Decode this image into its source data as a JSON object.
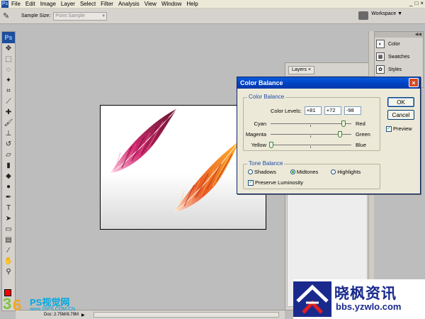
{
  "app": {
    "logo": "Ps",
    "menu": [
      "File",
      "Edit",
      "Image",
      "Layer",
      "Select",
      "Filter",
      "Analysis",
      "View",
      "Window",
      "Help"
    ],
    "window_buttons": [
      "_",
      "□",
      "×"
    ]
  },
  "options_bar": {
    "sample_size_label": "Sample Size:",
    "sample_size_value": "Point Sample",
    "workspace_label": "Workspace ▼"
  },
  "panels": {
    "layers_tab": "Layers ×",
    "dock_items": [
      {
        "label": "Color",
        "icon": "color-icon"
      },
      {
        "label": "Swatches",
        "icon": "swatches-icon"
      },
      {
        "label": "Styles",
        "icon": "styles-icon"
      }
    ]
  },
  "status": {
    "doc_info": "Doc: 2.75M/8.79M"
  },
  "dialog": {
    "title": "Color Balance",
    "close_glyph": "×",
    "color_balance": {
      "group_label": "Color Balance",
      "levels_label": "Color Levels:",
      "levels": [
        "+81",
        "+72",
        "-98"
      ],
      "sliders": [
        {
          "left": "Cyan",
          "right": "Red",
          "value": 81
        },
        {
          "left": "Magenta",
          "right": "Green",
          "value": 72
        },
        {
          "left": "Yellow",
          "right": "Blue",
          "value": -98
        }
      ]
    },
    "tone_balance": {
      "group_label": "Tone Balance",
      "options": [
        "Shadows",
        "Midtones",
        "Highlights"
      ],
      "selected": "Midtones",
      "preserve_luminosity": "Preserve Luminosity"
    },
    "buttons": {
      "ok": "OK",
      "cancel": "Cancel",
      "preview": "Preview"
    }
  },
  "watermarks": {
    "left_title": "PS视觉网",
    "left_url": "www.16PS.COM.CN",
    "right_title": "晓枫资讯",
    "right_url": "bbs.yzwlo.com"
  },
  "colors": {
    "foreground": "#ff0000",
    "titlebar": "#0040c0",
    "brand_blue": "#1a2a8c"
  }
}
